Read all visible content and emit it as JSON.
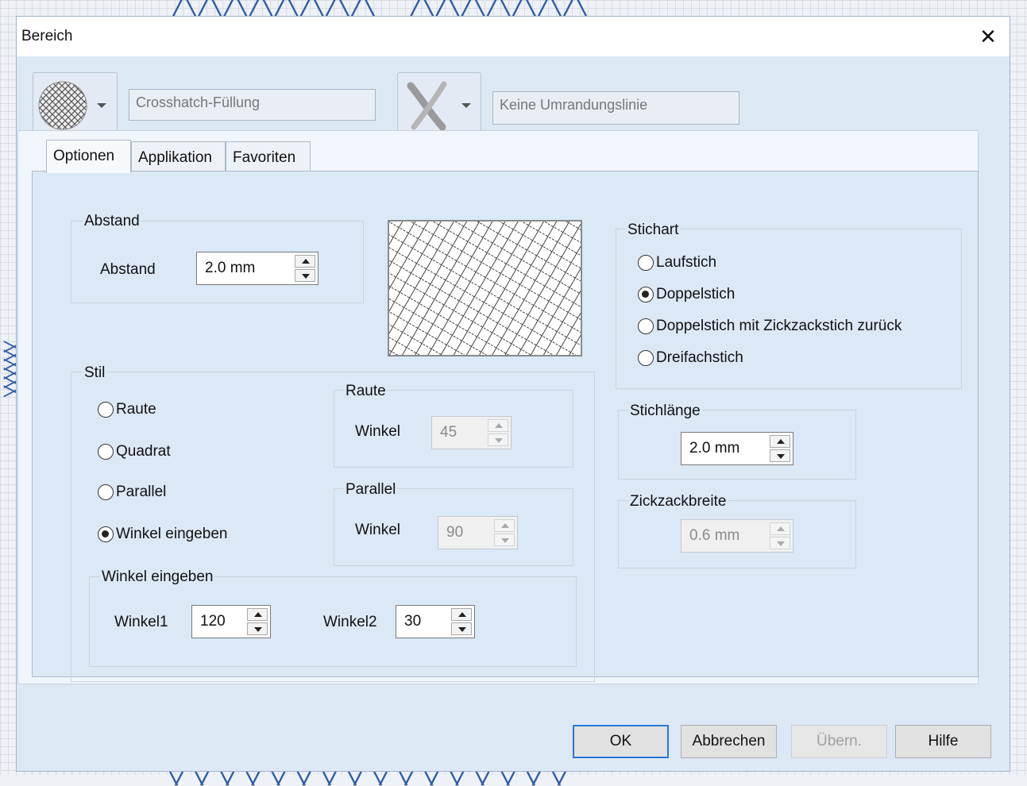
{
  "dialog": {
    "title": "Bereich",
    "close_glyph": "✕"
  },
  "fill": {
    "icon": "crosshatch-fill-icon",
    "name": "Crosshatch-Füllung"
  },
  "outline": {
    "icon": "no-outline-icon",
    "name": "Keine Umrandungslinie"
  },
  "tabs": [
    {
      "label": "Optionen",
      "active": true
    },
    {
      "label": "Applikation",
      "active": false
    },
    {
      "label": "Favoriten",
      "active": false
    }
  ],
  "abstand": {
    "group_label": "Abstand",
    "field_label": "Abstand",
    "value": "2.0 mm"
  },
  "stil": {
    "group_label": "Stil",
    "options": [
      {
        "label": "Raute",
        "selected": false
      },
      {
        "label": "Quadrat",
        "selected": false
      },
      {
        "label": "Parallel",
        "selected": false
      },
      {
        "label": "Winkel eingeben",
        "selected": true
      }
    ],
    "raute": {
      "group_label": "Raute",
      "field_label": "Winkel",
      "value": "45"
    },
    "parallel": {
      "group_label": "Parallel",
      "field_label": "Winkel",
      "value": "90"
    },
    "winkel_eingeben": {
      "group_label": "Winkel eingeben",
      "winkel1_label": "Winkel1",
      "winkel1_value": "120",
      "winkel2_label": "Winkel2",
      "winkel2_value": "30"
    }
  },
  "stichart": {
    "group_label": "Stichart",
    "options": [
      {
        "label": "Laufstich",
        "selected": false
      },
      {
        "label": "Doppelstich",
        "selected": true
      },
      {
        "label": "Doppelstich mit Zickzackstich zurück",
        "selected": false
      },
      {
        "label": "Dreifachstich",
        "selected": false
      }
    ]
  },
  "stichlaenge": {
    "group_label": "Stichlänge",
    "value": "2.0 mm"
  },
  "zickzackbreite": {
    "group_label": "Zickzackbreite",
    "value": "0.6 mm"
  },
  "buttons": {
    "ok": "OK",
    "cancel": "Abbrechen",
    "apply": "Übern.",
    "help": "Hilfe"
  }
}
